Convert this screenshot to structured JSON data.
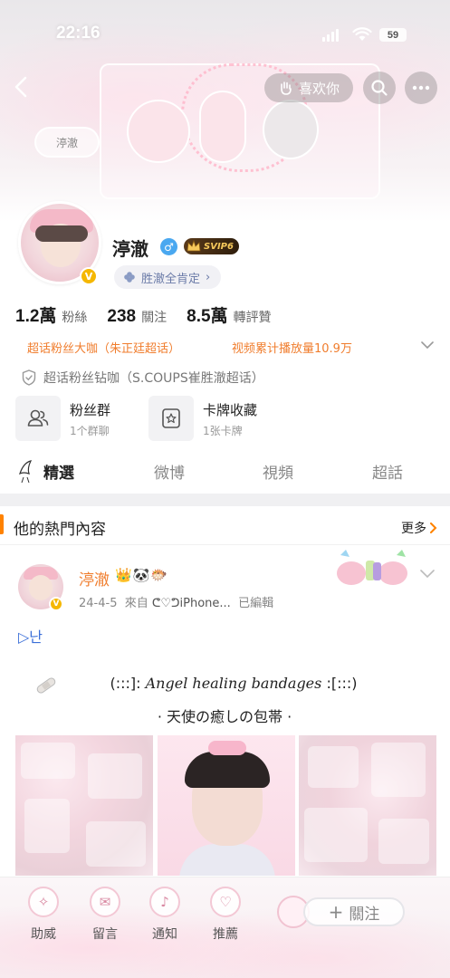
{
  "status_bar": {
    "time": "22:16",
    "battery": "59"
  },
  "banner": {
    "sticker_text": "渟澈"
  },
  "header": {
    "like_label": "喜欢你"
  },
  "profile": {
    "name": "渟澈",
    "svip_label": "SVIP6",
    "approval_label": "胜澈全肯定",
    "stats": [
      {
        "value": "1.2萬",
        "label": "粉絲"
      },
      {
        "value": "238",
        "label": "關注"
      },
      {
        "value": "8.5萬",
        "label": "轉評贊"
      }
    ],
    "honors": {
      "left": "超话粉丝大咖（朱正廷超话）",
      "right": "视频累计播放量10.9万"
    },
    "fan_badge": "超话粉丝钻咖（S.COUPS崔胜澈超话）",
    "cards": [
      {
        "title": "粉丝群",
        "sub": "1个群聊"
      },
      {
        "title": "卡牌收藏",
        "sub": "1张卡牌"
      }
    ]
  },
  "tabs": [
    "精選",
    "微博",
    "視頻",
    "超話"
  ],
  "section": {
    "title": "他的熱門內容",
    "more": "更多"
  },
  "post": {
    "author": "渟澈",
    "author_emoji": "👑🐼🐡",
    "date": "24-4-5",
    "source_prefix": "來自",
    "source": "ᕦ♡ᕤiPhone...",
    "edited": "已編輯",
    "line1": "▷난",
    "line2_pre": "(:::]:",
    "line2_italic": " Angel healing bandages ",
    "line2_post": ":[:::)",
    "line3": "· 天使の癒しの包帯 ·"
  },
  "bottom_bar": {
    "items": [
      "助威",
      "留言",
      "通知",
      "推薦"
    ],
    "follow": "關注"
  },
  "colors": {
    "accent_orange": "#f07d2d",
    "section_bar": "#ff8200",
    "verified_gold": "#f5b700",
    "link_blue": "#3b6fd8"
  }
}
